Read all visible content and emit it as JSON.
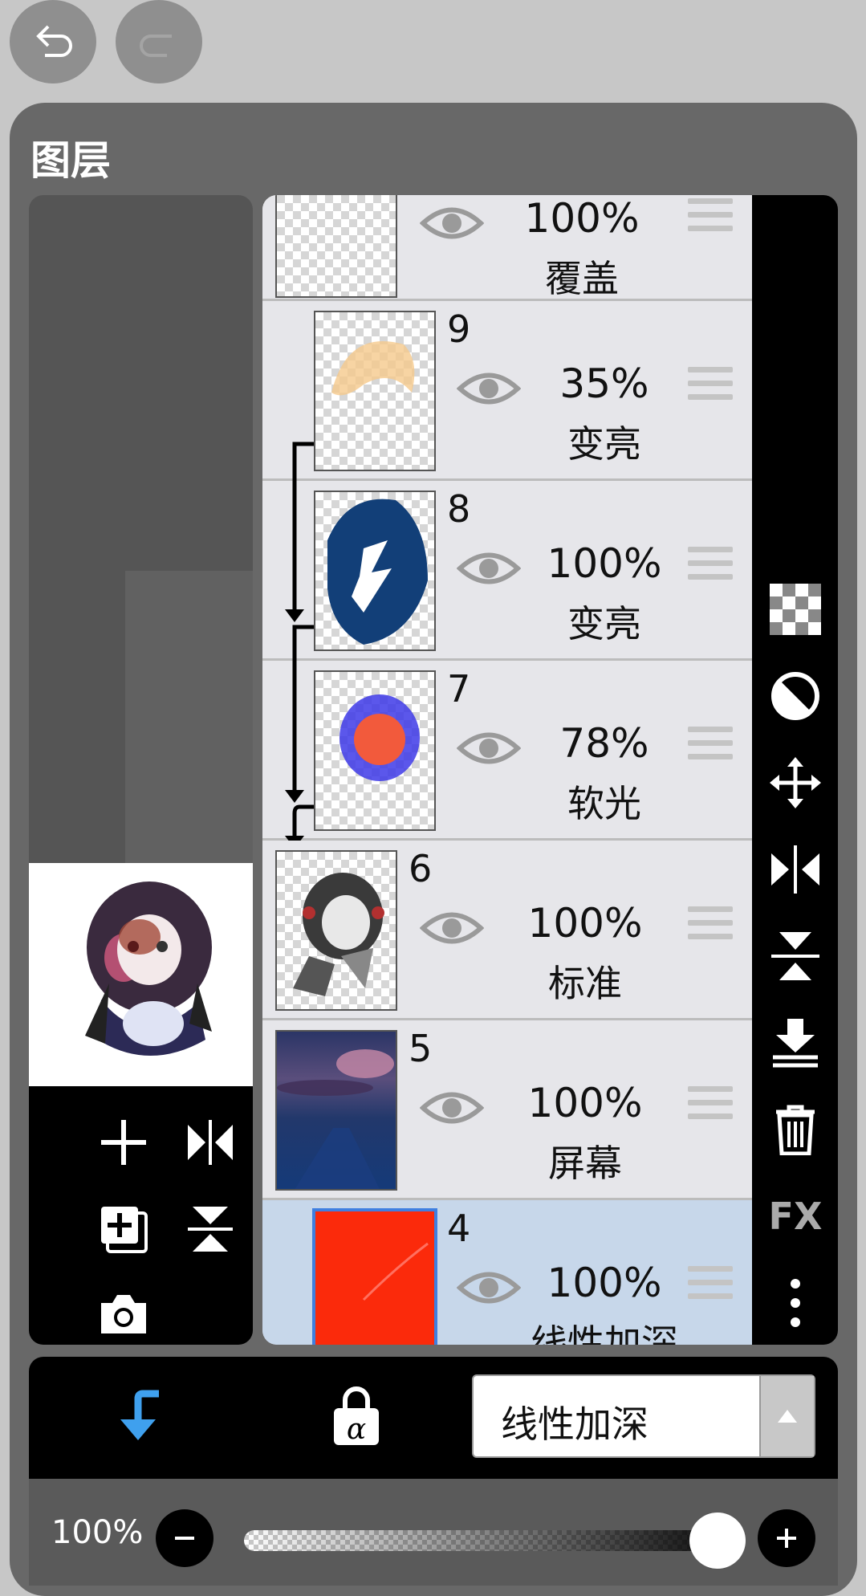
{
  "panel": {
    "title": "图层"
  },
  "layers": [
    {
      "number": "",
      "opacity": "100%",
      "mode": "覆盖",
      "selected": false
    },
    {
      "number": "9",
      "opacity": "35%",
      "mode": "变亮",
      "selected": false
    },
    {
      "number": "8",
      "opacity": "100%",
      "mode": "变亮",
      "selected": false
    },
    {
      "number": "7",
      "opacity": "78%",
      "mode": "软光",
      "selected": false
    },
    {
      "number": "6",
      "opacity": "100%",
      "mode": "标准",
      "selected": false
    },
    {
      "number": "5",
      "opacity": "100%",
      "mode": "屏幕",
      "selected": false
    },
    {
      "number": "4",
      "opacity": "100%",
      "mode": "线性加深",
      "selected": true
    }
  ],
  "blend": {
    "selected_mode": "线性加深"
  },
  "opacity": {
    "label": "100%",
    "value": 1.0
  },
  "right_tools": [
    "checkerboard-icon",
    "adjust-icon",
    "move-icon",
    "flip-horizontal-icon",
    "flip-vertical-icon",
    "merge-down-icon",
    "trash-icon",
    "fx-icon",
    "more-icon"
  ],
  "fx_label": "FX",
  "colors": {
    "accent": "#3fa0ee",
    "selected_layer": "#c7d7ea",
    "layer_bg": "#e6e6ea"
  }
}
